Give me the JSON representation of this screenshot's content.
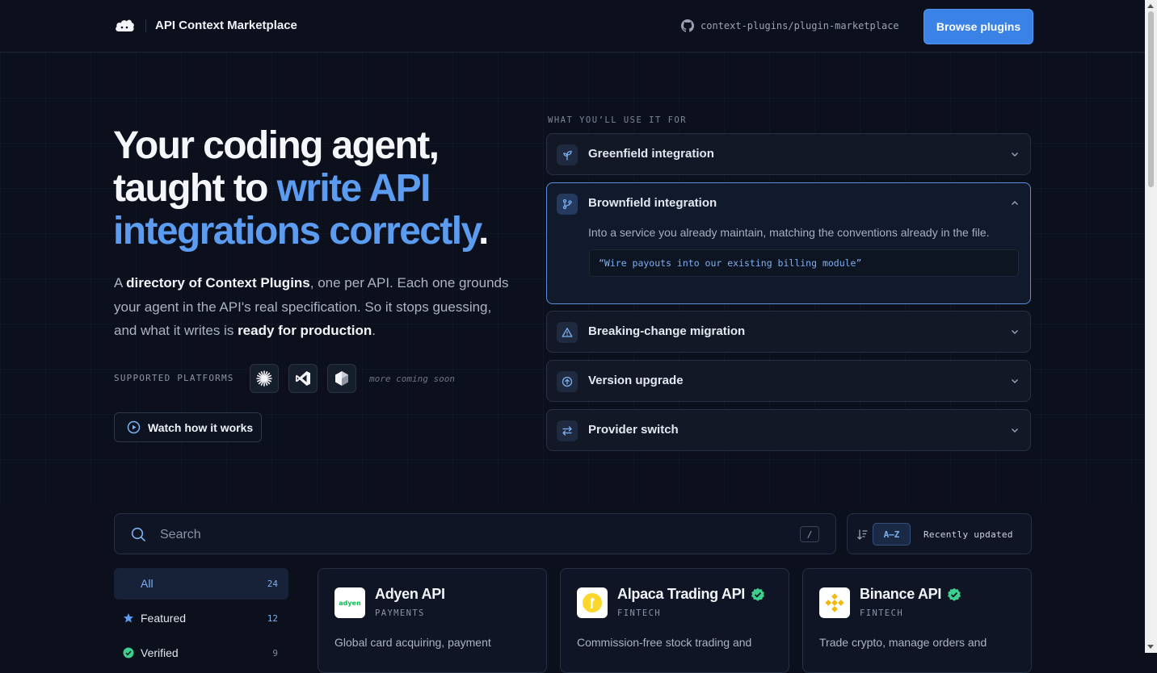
{
  "header": {
    "app_title": "API Context Marketplace",
    "repo": "context-plugins/plugin-marketplace",
    "browse_button": "Browse plugins"
  },
  "hero": {
    "title_line1": "Your coding agent,",
    "title_line2_plain": "taught to ",
    "title_line2_accent": "write API",
    "title_line3_accent": "integrations correctly",
    "title_line3_dot": ".",
    "desc_1": "A ",
    "desc_bold1": "directory of Context Plugins",
    "desc_2": ", one per API. Each one grounds your agent in the API's real specification. So it stops guessing, and what it writes is ",
    "desc_bold2": "ready for production",
    "desc_3": ".",
    "platforms_label": "SUPPORTED PLATFORMS",
    "more_coming": "more coming soon",
    "watch_button": "Watch how it works"
  },
  "use_cases": {
    "label": "WHAT YOU’LL USE IT FOR",
    "items": [
      {
        "title": "Greenfield integration",
        "icon": "sprout-icon",
        "open": false
      },
      {
        "title": "Brownfield integration",
        "icon": "git-branch-icon",
        "open": true,
        "body": "Into a service you already maintain, matching the conventions already in the file.",
        "quote": "“Wire payouts into our existing billing module”"
      },
      {
        "title": "Breaking-change migration",
        "icon": "warning-icon",
        "open": false
      },
      {
        "title": "Version upgrade",
        "icon": "arrow-up-circle-icon",
        "open": false
      },
      {
        "title": "Provider switch",
        "icon": "swap-icon",
        "open": false
      }
    ]
  },
  "search": {
    "placeholder": "Search",
    "shortcut": "/",
    "sort_az": "A–Z",
    "sort_recent": "Recently updated"
  },
  "filters": [
    {
      "label": "All",
      "count": "24",
      "active": true
    },
    {
      "label": "Featured",
      "count": "12",
      "active": false
    },
    {
      "label": "Verified",
      "count": "9",
      "active": false
    }
  ],
  "cards": [
    {
      "name": "Adyen API",
      "category": "PAYMENTS",
      "desc": "Global card acquiring, payment",
      "verified": false,
      "logo_text": "adyen",
      "logo_color": "#0abf53"
    },
    {
      "name": "Alpaca Trading API",
      "category": "FINTECH",
      "desc": "Commission-free stock trading and",
      "verified": true,
      "logo_color": "#fcd72b"
    },
    {
      "name": "Binance API",
      "category": "FINTECH",
      "desc": "Trade crypto, manage orders and",
      "verified": true,
      "logo_color": "#f0b90b"
    }
  ],
  "colors": {
    "accent": "#3a82e6",
    "accent_text": "#5b9bf0",
    "verified": "#3ecf8e",
    "background": "#0b101c"
  }
}
